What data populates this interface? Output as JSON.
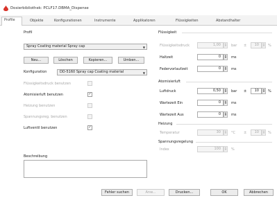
{
  "window": {
    "title": "Dosierbibliothek: PCLF17.DBMA_Dispense"
  },
  "tabs": [
    "Profile",
    "Objekte",
    "Konfigurationen",
    "Instrumente",
    "Applikatoren",
    "Flüssigkeiten",
    "Abstandhalter"
  ],
  "left": {
    "profil_label": "Profil",
    "profil_value": "Spray Coating material Spray cap",
    "buttons": {
      "new": "Neu...",
      "delete": "Löschen",
      "copy": "Kopieren...",
      "rename": "Umben..."
    },
    "konfiguration_label": "Konfiguration",
    "konfiguration_value": "DD-5160 Spray cap Coating material",
    "options": [
      {
        "label": "Flüssigkeitsdruck benutzen",
        "checked": "",
        "enabled": false
      },
      {
        "label": "Atomisierluft benutzen",
        "checked": "✓",
        "enabled": true
      },
      {
        "label": "Heizung benutzen",
        "checked": "",
        "enabled": false
      },
      {
        "label": "Spannungsreg. benutzen",
        "checked": "",
        "enabled": false
      },
      {
        "label": "Luftventil benutzen",
        "checked": "✓",
        "enabled": true
      }
    ],
    "beschreibung_label": "Beschreibung"
  },
  "right": {
    "fluessigkeit": {
      "heading": "Flüssigkeit",
      "druck_label": "Flüssigkeitsdruck",
      "druck_value": "1,00",
      "druck_unit": "bar",
      "druck_tol_sep": "±",
      "druck_tol": "10",
      "druck_tol_unit": "%",
      "haltzeit_label": "Haltzeit",
      "haltzeit_value": "0",
      "haltzeit_unit": "ms",
      "federvor_label": "Federvorlaufzeit",
      "federvor_value": "0",
      "federvor_unit": "ms"
    },
    "atomisier": {
      "heading": "Atomisierluft",
      "luftdruck_label": "Luftdruck",
      "luftdruck_value": "0,50",
      "luftdruck_unit": "bar",
      "luftdruck_tol_sep": "±",
      "luftdruck_tol": "10",
      "luftdruck_tol_unit": "%",
      "wait_on_label": "Wartezeit Ein",
      "wait_on_value": "0",
      "wait_on_unit": "ms",
      "wait_off_label": "Wartezeit Aus",
      "wait_off_value": "0",
      "wait_off_unit": "ms"
    },
    "heizung": {
      "heading": "Heizung",
      "temp_label": "Temperatur",
      "temp_value": "30",
      "temp_unit": "°C",
      "temp_tol_sep": "±",
      "temp_tol": "10",
      "temp_tol_unit": "%"
    },
    "spannung": {
      "heading": "Spannungsregelung",
      "index_label": "Index",
      "index_value": "100",
      "index_unit": "%"
    }
  },
  "footer": {
    "check": "Fehler suchen",
    "apply": "Anw...",
    "print": "Drucken...",
    "ok": "OK",
    "cancel": "Abbrechen"
  }
}
